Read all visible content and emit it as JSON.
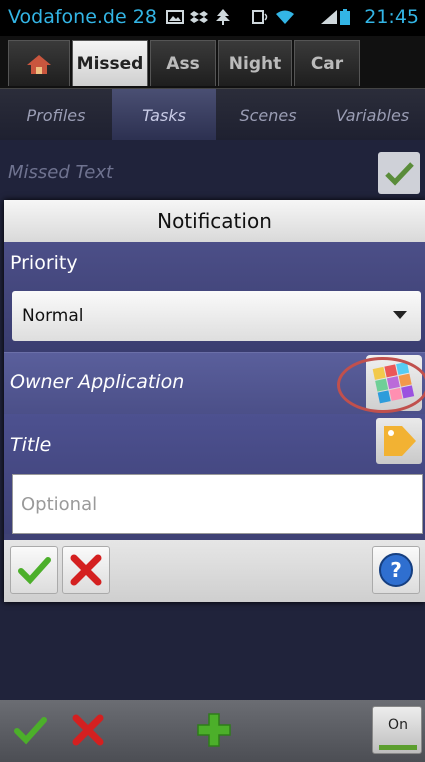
{
  "status_bar": {
    "carrier": "Vodafone.de 28",
    "time": "21:45",
    "icons": [
      "gallery-icon",
      "dropbox-icon",
      "tree-icon",
      "cast-icon",
      "wifi-icon",
      "signal-icon",
      "battery-icon"
    ]
  },
  "project_tabs": [
    {
      "label": "",
      "icon": "home-icon"
    },
    {
      "label": "Missed",
      "active": true
    },
    {
      "label": "Ass"
    },
    {
      "label": "Night"
    },
    {
      "label": "Car"
    }
  ],
  "section_tabs": [
    {
      "label": "Profiles"
    },
    {
      "label": "Tasks",
      "active": true
    },
    {
      "label": "Scenes"
    },
    {
      "label": "Variables"
    }
  ],
  "background": {
    "task_name": "Missed Text"
  },
  "dialog": {
    "title": "Notification",
    "priority": {
      "label": "Priority",
      "value": "Normal"
    },
    "owner_application": {
      "label": "Owner Application"
    },
    "title_field": {
      "label": "Title",
      "placeholder": "Optional",
      "value": ""
    }
  },
  "bottom_bar": {
    "toggle_label": "On"
  },
  "colors": {
    "accent": "#33b5e5",
    "dialog_bg": "#3f4275",
    "annotation": "#c0504d",
    "ok": "#4caf2a",
    "cancel": "#d42020"
  }
}
